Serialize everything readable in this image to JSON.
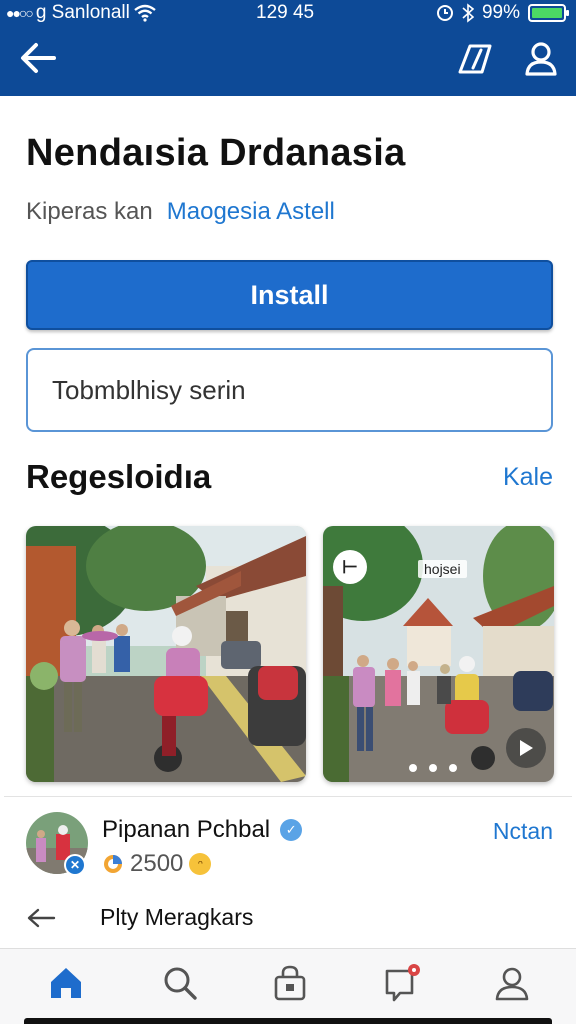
{
  "status_bar": {
    "carrier": "g Sanlonall",
    "time": "129 45",
    "battery": "99%",
    "battery_level": 0.99
  },
  "app": {
    "title": "Nendaısia Drdanasia",
    "developer_prefix": "Kiperas kan",
    "developer_name": "Maogesia Astell",
    "install_label": "Install",
    "search_value": "Tobmblhisy serin"
  },
  "screenshots": {
    "title": "Regesloidıa",
    "link_label": "Kale",
    "cards": [
      {
        "tag": ""
      },
      {
        "tag": "hojsei"
      }
    ]
  },
  "review": {
    "user_name": "Pipanan Pchbal",
    "count": "2500",
    "action_label": "Nctan",
    "sub_label": "Plty Meragkars"
  },
  "colors": {
    "brand": "#0d4a97",
    "accent": "#1f77d0",
    "install": "#1e6ccc"
  },
  "icons": [
    "back-arrow-icon",
    "edit-icon",
    "profile-icon",
    "home-icon",
    "search-icon",
    "store-bag-icon",
    "chat-icon",
    "account-icon"
  ]
}
